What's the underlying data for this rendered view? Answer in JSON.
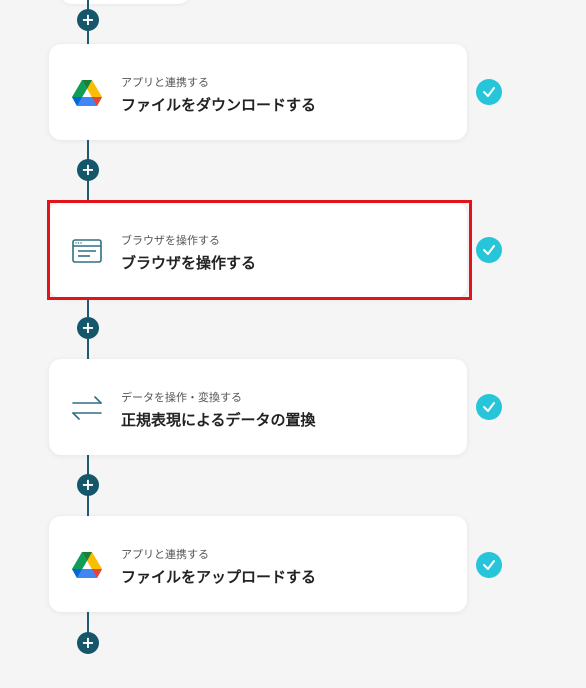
{
  "steps": [
    {
      "category": "アプリと連携する",
      "title": "ファイルをダウンロードする",
      "icon": "google-drive-icon",
      "status": "completed"
    },
    {
      "category": "ブラウザを操作する",
      "title": "ブラウザを操作する",
      "icon": "browser-window-icon",
      "status": "completed"
    },
    {
      "category": "データを操作・変換する",
      "title": "正規表現によるデータの置換",
      "icon": "swap-arrows-icon",
      "status": "completed"
    },
    {
      "category": "アプリと連携する",
      "title": "ファイルをアップロードする",
      "icon": "google-drive-icon",
      "status": "completed"
    }
  ],
  "add_button_label": "+",
  "colors": {
    "connector": "#1e5a6f",
    "add_button": "#16566b",
    "check": "#27c5d9",
    "highlight": "#e1141c"
  }
}
